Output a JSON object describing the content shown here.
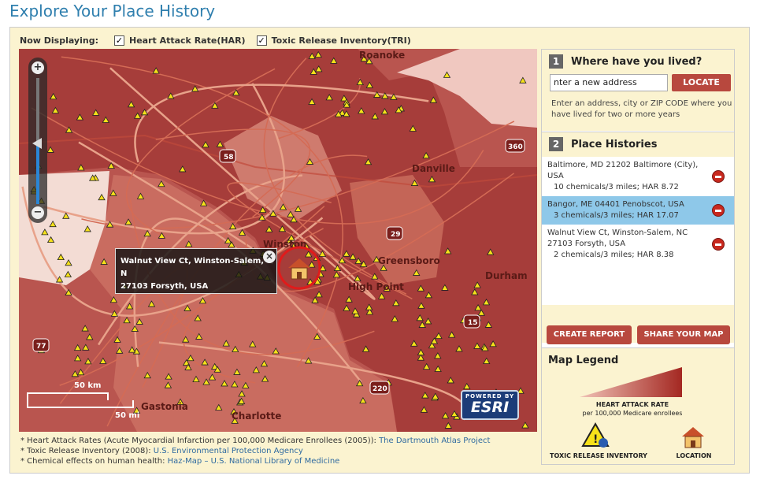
{
  "page": {
    "title": "Explore Your Place History"
  },
  "toolbar": {
    "now_displaying_label": "Now Displaying:",
    "layers": [
      {
        "label": "Heart Attack Rate(HAR)",
        "checked": true
      },
      {
        "label": "Toxic Release Inventory(TRI)",
        "checked": true
      }
    ]
  },
  "map": {
    "city_labels": [
      "Roanoke",
      "Danville",
      "Winston",
      "Greensboro",
      "High Point",
      "Durham",
      "Gastonia",
      "Charlotte"
    ],
    "highway_shields": [
      "58",
      "29",
      "360",
      "15",
      "220",
      "77"
    ],
    "popup": {
      "line1": "Walnut View Ct, Winston-Salem, N",
      "line2": "27103 Forsyth, USA"
    },
    "scale": {
      "km_label": "50 km",
      "mi_label": "50 mi"
    },
    "esri": {
      "powered_by": "POWERED BY",
      "brand": "ESRI"
    }
  },
  "sources": [
    {
      "text": "* Heart Attack Rates (Acute Myocardial Infarction per 100,000 Medicare Enrollees (2005)): ",
      "link": "The Dartmouth Atlas Project"
    },
    {
      "text": "* Toxic Release Inventory (2008): ",
      "link": "U.S. Environmental Protection Agency"
    },
    {
      "text": "* Chemical effects on human health: ",
      "link": "Haz-Map – U.S. National Library of Medicine"
    }
  ],
  "panel": {
    "step1": {
      "number": "1",
      "heading": "Where have you lived?",
      "address_value": "nter a new address",
      "locate_label": "LOCATE",
      "hint": "Enter an address, city or ZIP CODE where you have lived for two or more years"
    },
    "step2": {
      "number": "2",
      "heading": "Place Histories"
    },
    "histories": [
      {
        "address": "Baltimore, MD 21202 Baltimore (City), USA",
        "metrics": "10 chemicals/3 miles; HAR 8.72",
        "selected": false
      },
      {
        "address": "Bangor, ME 04401 Penobscot, USA",
        "metrics": "3 chemicals/3 miles; HAR 17.07",
        "selected": true
      },
      {
        "address": "Walnut View Ct, Winston-Salem, NC 27103 Forsyth, USA",
        "metrics": "2 chemicals/3 miles; HAR 8.38",
        "selected": false
      }
    ],
    "create_report_label": "CREATE REPORT",
    "share_map_label": "SHARE YOUR MAP",
    "legend": {
      "title": "Map Legend",
      "har_label": "HEART ATTACK RATE",
      "har_sublabel": "per 100,000 Medicare enrollees",
      "tri_label": "TOXIC RELEASE INVENTORY",
      "location_label": "LOCATION"
    }
  },
  "colors": {
    "accent": "#2f7fae",
    "button": "#b8483e",
    "panel_bg": "#fbf3d0",
    "selected_row": "#8ec8e9"
  }
}
